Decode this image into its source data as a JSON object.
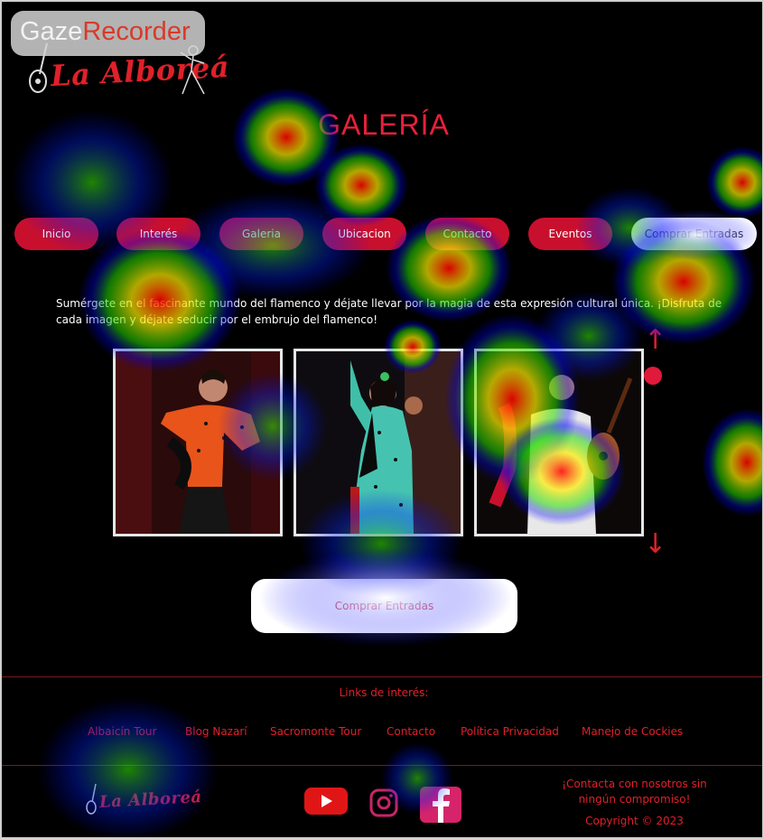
{
  "watermark": {
    "part1": "Gaze",
    "part2": "Recorder"
  },
  "logo": {
    "text": "La Alboreá"
  },
  "page_title": "GALERÍA",
  "nav": [
    {
      "label": "Inicio"
    },
    {
      "label": "Interés"
    },
    {
      "label": "Galeria"
    },
    {
      "label": "Ubicacion"
    },
    {
      "label": "Contacto"
    },
    {
      "label": "Eventos"
    },
    {
      "label": "Comprar Entradas"
    }
  ],
  "intro_text": "Sumérgete en el fascinante mundo del flamenco y déjate llevar por la magia de esta expresión cultural única. ¡Disfruta de cada imagen y déjate seducir por el embrujo del flamenco!",
  "gallery": {
    "photos": [
      "flamenco-dancer-red",
      "flamenco-dancer-turquoise",
      "flamenco-guitarist"
    ],
    "scroll_up_icon": "↑",
    "scroll_down_icon": "↓"
  },
  "buy_button": "Comprar Entradas",
  "footer": {
    "links_title": "Links de interés:",
    "links": [
      "Albaicín Tour",
      "Blog Nazarí",
      "Sacromonte Tour",
      "Contacto",
      "Política Privacidad",
      "Manejo de Cockies"
    ],
    "contact_text": "¡Contacta con nosotros sin ningún compromiso!",
    "copyright": "Copyright © 2023",
    "social": [
      "youtube-icon",
      "instagram-icon",
      "facebook-icon"
    ]
  },
  "colors": {
    "accent": "#c8102e",
    "background": "#000000",
    "link": "#e0202a"
  }
}
